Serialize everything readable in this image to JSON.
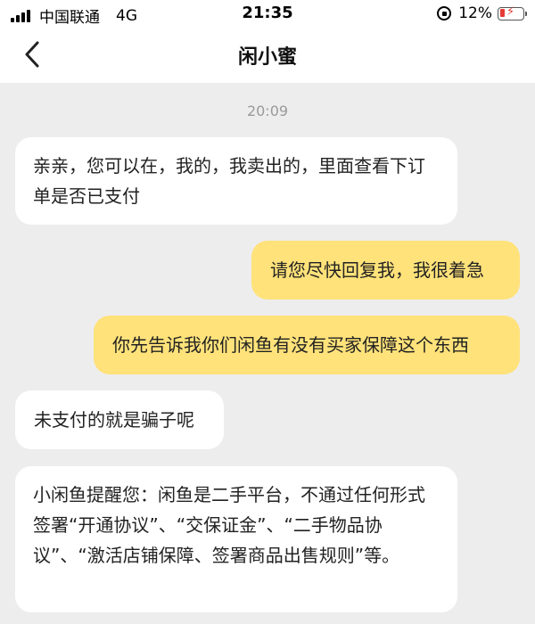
{
  "status_bar": {
    "carrier": "中国联通",
    "network": "4G",
    "time": "21:35",
    "battery_percent": "12%",
    "icons": [
      "signal-icon",
      "orientation-lock-icon",
      "battery-charging-icon"
    ],
    "battery_color": "#e53935"
  },
  "nav": {
    "title": "闲小蜜",
    "back_icon": "chevron-left-icon"
  },
  "chat": {
    "timestamp": "20:09",
    "messages": [
      {
        "side": "incoming",
        "text": "亲亲，您可以在，我的，我卖出的，里面查看下订单是否已支付"
      },
      {
        "side": "outgoing",
        "text": "请您尽快回复我，我很着急"
      },
      {
        "side": "outgoing",
        "text": "你先告诉我你们闲鱼有没有买家保障这个东西"
      },
      {
        "side": "incoming",
        "text": "未支付的就是骗子呢"
      },
      {
        "side": "incoming",
        "text": "小闲鱼提醒您：闲鱼是二手平台，不通过任何形式签署“开通协议”、“交保证金”、“二手物品协议”、“激活店铺保障、签署商品出售规则”等。"
      }
    ]
  },
  "colors": {
    "background": "#ededed",
    "incoming_bubble": "#ffffff",
    "outgoing_bubble": "#ffe27a",
    "timestamp": "#9a9a9a"
  }
}
